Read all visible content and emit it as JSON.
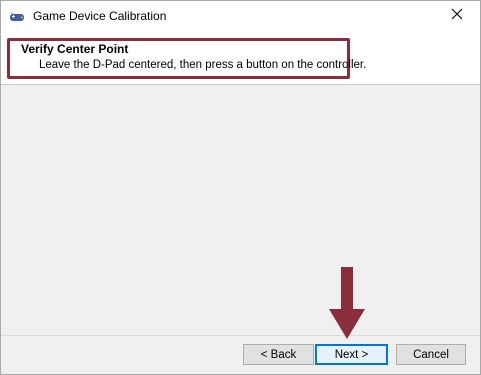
{
  "window": {
    "title": "Game Device Calibration",
    "close_icon": "close-icon",
    "app_icon": "gamepad-icon"
  },
  "header": {
    "title": "Verify Center Point",
    "subtitle": "Leave the D-Pad centered, then press a button on the controller."
  },
  "buttons": {
    "back": "< Back",
    "next": "Next >",
    "cancel": "Cancel"
  },
  "annotations": {
    "highlight_color": "#8b2e3c",
    "arrow_color": "#8b2e3c",
    "arrow_icon": "down-arrow-icon"
  }
}
